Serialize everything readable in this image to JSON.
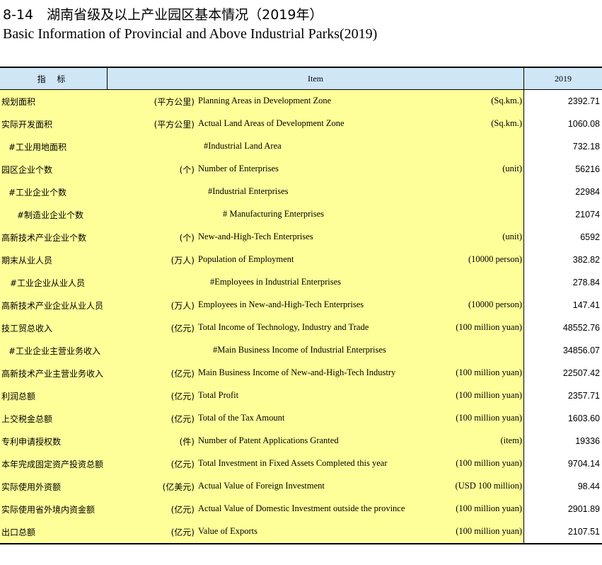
{
  "title": {
    "cn": "8-14　湖南省级及以上产业园区基本情况（2019年）",
    "en": "Basic Information of Provincial and Above Industrial Parks(2019)"
  },
  "header": {
    "indicator": "指 标",
    "item": "Item",
    "year": "2019"
  },
  "rows": [
    {
      "cn": "规划面积",
      "unit_cn": "(平方公里)",
      "en": "Planning Areas in Development Zone",
      "unit_en": "(Sq.km.)",
      "value": "2392.71"
    },
    {
      "cn": "实际开发面积",
      "unit_cn": "(平方公里)",
      "en": "Actual Land Areas of Development Zone",
      "unit_en": "(Sq.km.)",
      "value": "1060.08"
    },
    {
      "cn": "#工业用地面积",
      "unit_cn": "",
      "en": "#Industrial Land Area",
      "unit_en": "",
      "value": "732.18"
    },
    {
      "cn": "园区企业个数",
      "unit_cn": "(个)",
      "en": "Number of Enterprises",
      "unit_en": "(unit)",
      "value": "56216"
    },
    {
      "cn": "#工业企业个数",
      "unit_cn": "",
      "en": "#Industrial Enterprises",
      "unit_en": "",
      "value": "22984"
    },
    {
      "cn": "#制造业企业个数",
      "unit_cn": "",
      "en": "# Manufacturing Enterprises",
      "unit_en": "",
      "value": "21074"
    },
    {
      "cn": "高新技术产业企业个数",
      "unit_cn": "(个)",
      "en": "New-and-High-Tech Enterprises",
      "unit_en": "(unit)",
      "value": "6592"
    },
    {
      "cn": "期末从业人员",
      "unit_cn": "(万人)",
      "en": "Population of Employment",
      "unit_en": "(10000 person)",
      "value": "382.82"
    },
    {
      "cn": "#工业企业从业人员",
      "unit_cn": "",
      "en": "#Employees in Industrial Enterprises",
      "unit_en": "",
      "value": "278.84"
    },
    {
      "cn": "高新技术产业企业从业人员",
      "unit_cn": "(万人)",
      "en": "Employees in New-and-High-Tech Enterprises",
      "unit_en": "(10000 person)",
      "value": "147.41"
    },
    {
      "cn": "技工贸总收入",
      "unit_cn": "(亿元)",
      "en": "Total Income of Technology, Industry and Trade",
      "unit_en": "(100 million  yuan)",
      "value": "48552.76"
    },
    {
      "cn": "#工业企业主营业务收入",
      "unit_cn": "",
      "en": "#Main Business Income of Industrial Enterprises",
      "unit_en": "",
      "value": "34856.07"
    },
    {
      "cn": "高新技术产业主营业务收入",
      "unit_cn": "(亿元)",
      "en": "Main Business Income of  New-and-High-Tech Industry",
      "unit_en": "(100 million yuan)",
      "value": "22507.42"
    },
    {
      "cn": "利润总额",
      "unit_cn": "(亿元)",
      "en": "Total Profit",
      "unit_en": "(100 million yuan)",
      "value": "2357.71"
    },
    {
      "cn": "上交税金总额",
      "unit_cn": "(亿元)",
      "en": "Total of the Tax Amount",
      "unit_en": "(100 million yuan)",
      "value": "1603.60"
    },
    {
      "cn": "专利申请授权数",
      "unit_cn": "(件)",
      "en": "Number of Patent Applications  Granted",
      "unit_en": "(item)",
      "value": "19336"
    },
    {
      "cn": "本年完成固定资产投资总额",
      "unit_cn": "(亿元)",
      "en": "Total Investment in Fixed Assets Completed this year",
      "unit_en": "(100 million yuan)",
      "value": "9704.14"
    },
    {
      "cn": "实际使用外资额",
      "unit_cn": "(亿美元)",
      "en": "Actual Value of Foreign Investment",
      "unit_en": "(USD 100 million)",
      "value": "98.44"
    },
    {
      "cn": "实际使用省外境内资金额",
      "unit_cn": "(亿元)",
      "en": "Actual Value of  Domestic  Investment  outside the province",
      "unit_en": "(100 million yuan)",
      "value": "2901.89"
    },
    {
      "cn": "出口总额",
      "unit_cn": "(亿元)",
      "en": "Value of Exports",
      "unit_en": "(100 million yuan)",
      "value": "2107.51"
    }
  ]
}
